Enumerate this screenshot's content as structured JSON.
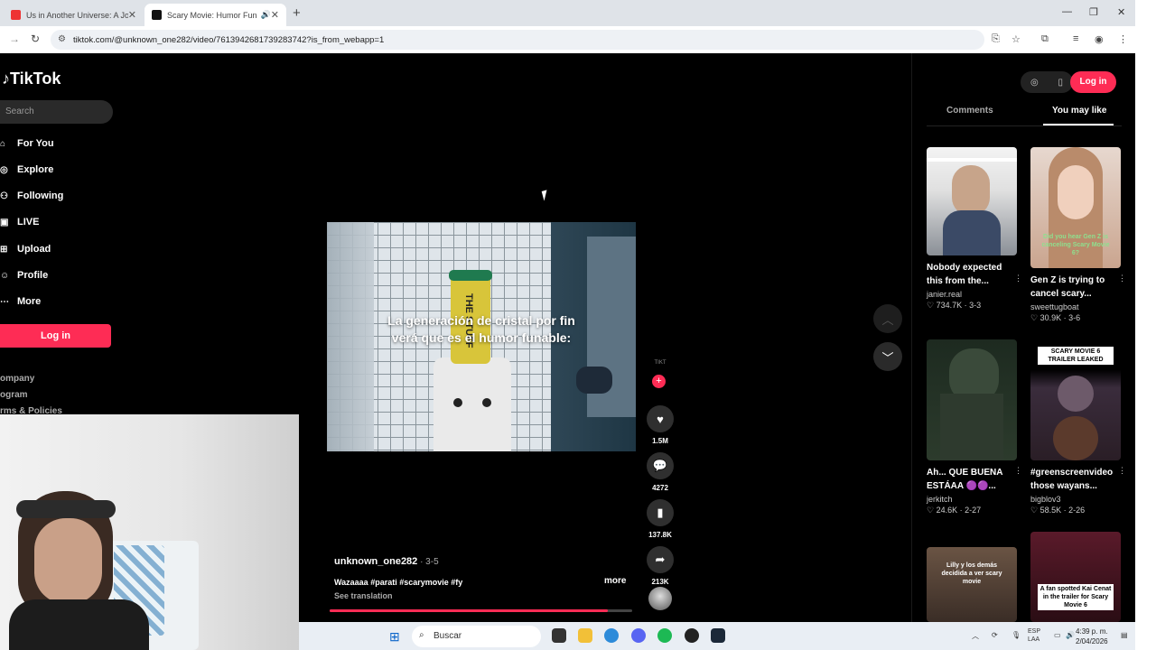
{
  "browser": {
    "tabs": [
      {
        "title": "Us in Another Universe: A Journ"
      },
      {
        "title": "Scary Movie: Humor Funab"
      }
    ],
    "new_tab": "+",
    "url": "tiktok.com/@unknown_one282/video/7613942681739283742?is_from_webapp=1",
    "minimize": "—",
    "maximize": "❐",
    "close": "✕"
  },
  "sidebar": {
    "logo": "TikTok",
    "search_placeholder": "Search",
    "nav": [
      {
        "label": "For You",
        "icon": "home-icon"
      },
      {
        "label": "Explore",
        "icon": "compass-icon"
      },
      {
        "label": "Following",
        "icon": "users-icon"
      },
      {
        "label": "LIVE",
        "icon": "live-icon"
      },
      {
        "label": "Upload",
        "icon": "upload-icon"
      },
      {
        "label": "Profile",
        "icon": "profile-icon"
      },
      {
        "label": "More",
        "icon": "more-icon"
      }
    ],
    "login": "Log in",
    "footer": [
      "ompany",
      "ogram",
      "rms & Policies"
    ]
  },
  "video": {
    "caption": "La generación de cristal por fin verá que es el humor funable:",
    "can_label": "THE STUFF",
    "author": "unknown_one282",
    "date": " · 3-5",
    "description": "Wazaaaa #parati #scarymovie #fy",
    "more": "more",
    "see_translation": "See translation",
    "progress": 0.92,
    "follow_plus": "+",
    "stats": {
      "likes": "1.5M",
      "comments": "4272",
      "saves": "137.8K",
      "shares": "213K"
    }
  },
  "right_panel": {
    "login": "Log in",
    "tabs": [
      {
        "label": "Comments"
      },
      {
        "label": "You may like"
      }
    ],
    "active_tab": "You may like",
    "cards": [
      {
        "title": "Nobody expected this from the...",
        "user": "janier.real",
        "stats": "♡ 734.7K · 3-3"
      },
      {
        "title": "Gen Z is trying to cancel scary...",
        "user": "sweettugboat",
        "stats": "♡ 30.9K · 3-6",
        "overlay": "Did you hear Gen Z is canceling Scary Movie 6?"
      },
      {
        "title": "Ah... QUE BUENA ESTÁAA 🟣🟣...",
        "user": "jerkitch",
        "stats": "♡ 24.6K · 2-27"
      },
      {
        "title": "#greenscreenvideo those wayans...",
        "user": "bigblov3",
        "stats": "♡ 58.5K · 2-26",
        "overlay": "SCARY MOVIE 6 TRAILER LEAKED"
      },
      {
        "overlay": "Lilly y los demás decidida a ver scary movie"
      },
      {
        "overlay": "A fan spotted Kai Cenat in the trailer for Scary Movie 6"
      }
    ]
  },
  "taskbar": {
    "search": "Buscar",
    "lang": "ESP\nLAA",
    "time": "4:39 p. m.",
    "date": "2/04/2026"
  },
  "colors": {
    "accent": "#fe2c55",
    "background": "#000000"
  }
}
